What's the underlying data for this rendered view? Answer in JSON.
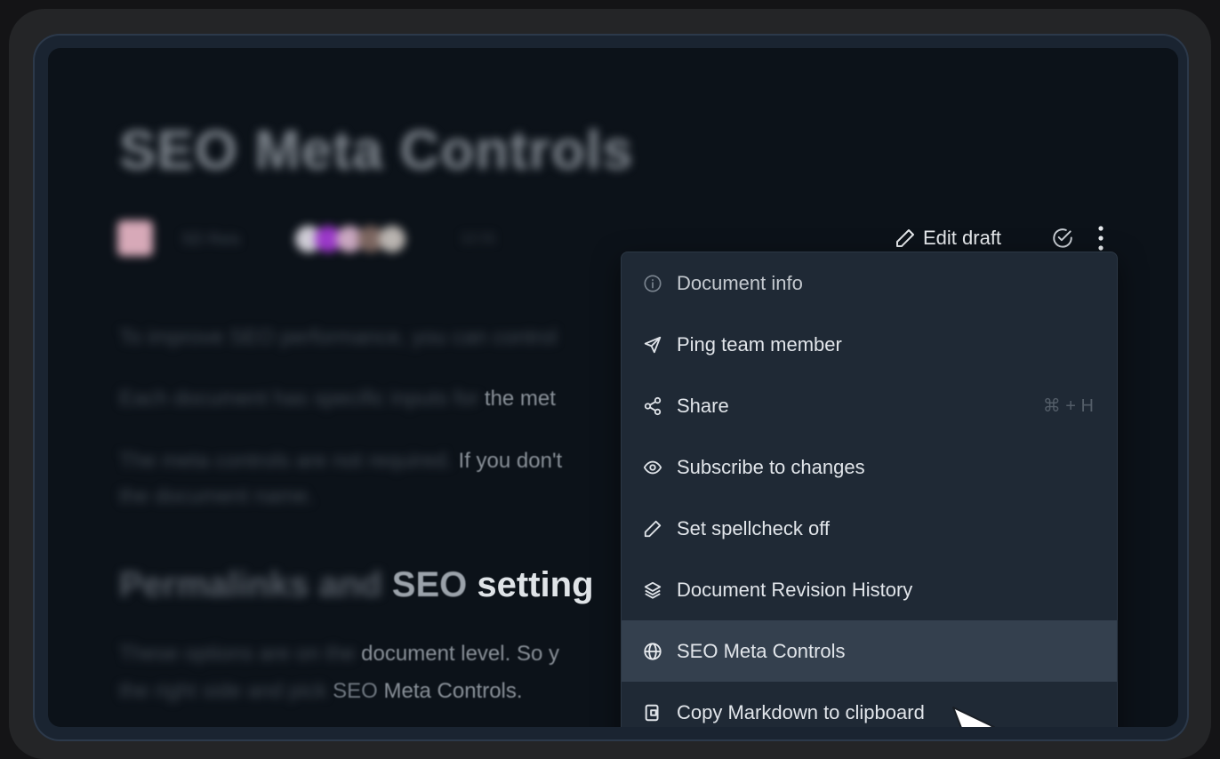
{
  "document": {
    "title": "SEO Meta Controls",
    "author": "SD Reis",
    "updated": "12:31",
    "paragraphs": [
      {
        "hidden": "To improve SEO performance, you can control",
        "visible": ""
      },
      {
        "hidden": "Each document has specific inputs for",
        "visible": " the met"
      },
      {
        "hidden": "The meta controls are not required.",
        "visible": " If you don't"
      },
      {
        "hidden": "the document name.",
        "visible": ""
      }
    ],
    "heading": {
      "hidden": "Permalinks and ",
      "visible_dim": "SEO ",
      "visible": "setting"
    },
    "lower_paragraphs": [
      {
        "hidden": "These options are on the",
        "visible": " document level. So y"
      },
      {
        "hidden": "the right side and pick ",
        "visible_dim": "SEO",
        "visible": " Meta Controls."
      }
    ]
  },
  "actions": {
    "edit_draft": "Edit draft"
  },
  "menu": {
    "items": [
      {
        "label": "Document info",
        "icon": "info-icon"
      },
      {
        "label": "Ping team member",
        "icon": "send-icon"
      },
      {
        "label": "Share",
        "icon": "share-icon",
        "shortcut": "⌘ + H"
      },
      {
        "label": "Subscribe to changes",
        "icon": "eye-icon"
      },
      {
        "label": "Set spellcheck off",
        "icon": "pencil-icon"
      },
      {
        "label": "Document Revision History",
        "icon": "layers-icon"
      },
      {
        "label": "SEO Meta Controls",
        "icon": "globe-icon",
        "hovered": true
      },
      {
        "label": "Copy Markdown to clipboard",
        "icon": "clipboard-icon"
      }
    ]
  },
  "colors": {
    "menu_bg": "#1f2935",
    "menu_hover": "#34404e",
    "screen_bg": "#0c1219"
  }
}
